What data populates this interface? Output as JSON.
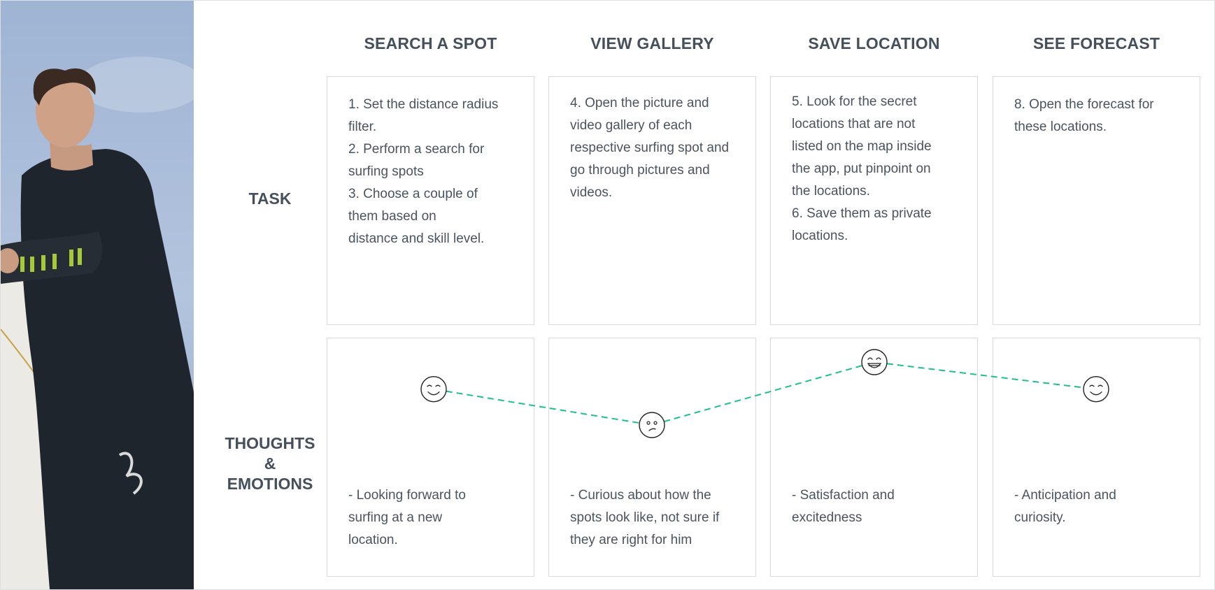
{
  "columns": [
    {
      "title": "SEARCH A SPOT"
    },
    {
      "title": "VIEW GALLERY"
    },
    {
      "title": "SAVE LOCATION"
    },
    {
      "title": "SEE FORECAST"
    }
  ],
  "rows": {
    "task": {
      "label": "TASK"
    },
    "thoughts": {
      "label_lines": [
        "THOUGHTS",
        "&",
        "EMOTIONS"
      ]
    }
  },
  "tasks": [
    {
      "lines": [
        "1. Set the distance radius",
        "filter.",
        "2. Perform a search for",
        "surfing spots",
        "3. Choose a couple of",
        "them based on",
        "distance and skill level."
      ]
    },
    {
      "lines": [
        "4. Open the picture and",
        "video gallery of each",
        "respective surfing spot and",
        "go through pictures and",
        "videos."
      ]
    },
    {
      "lines": [
        "5. Look for the secret",
        "locations that are not",
        "listed on the map inside",
        "the app, put pinpoint on",
        "the locations.",
        "6. Save them as private",
        "locations."
      ]
    },
    {
      "lines": [
        "8. Open the forecast for",
        "these locations."
      ]
    }
  ],
  "thoughts": [
    {
      "lines": [
        "- Looking forward to",
        "surfing at a new",
        "location."
      ]
    },
    {
      "lines": [
        "- Curious about how the",
        "spots look like, not sure if",
        "they are right for him"
      ]
    },
    {
      "lines": [
        "- Satisfaction and",
        "excitedness"
      ]
    },
    {
      "lines": [
        "- Anticipation and",
        "curiosity."
      ]
    }
  ],
  "emotions": [
    {
      "face": "content-smile-icon",
      "level": 0.57
    },
    {
      "face": "confused-face-icon",
      "level": 0.0
    },
    {
      "face": "happy-grin-icon",
      "level": 1.0
    },
    {
      "face": "content-smile-icon",
      "level": 0.57
    }
  ],
  "colors": {
    "heading": "#46505c",
    "card_border": "#d7dadd",
    "emotion_line": "#1dbf92",
    "sky": "#a9bcd8",
    "wetsuit": "#1f252c",
    "accent_stripes": "#a6c93a"
  }
}
